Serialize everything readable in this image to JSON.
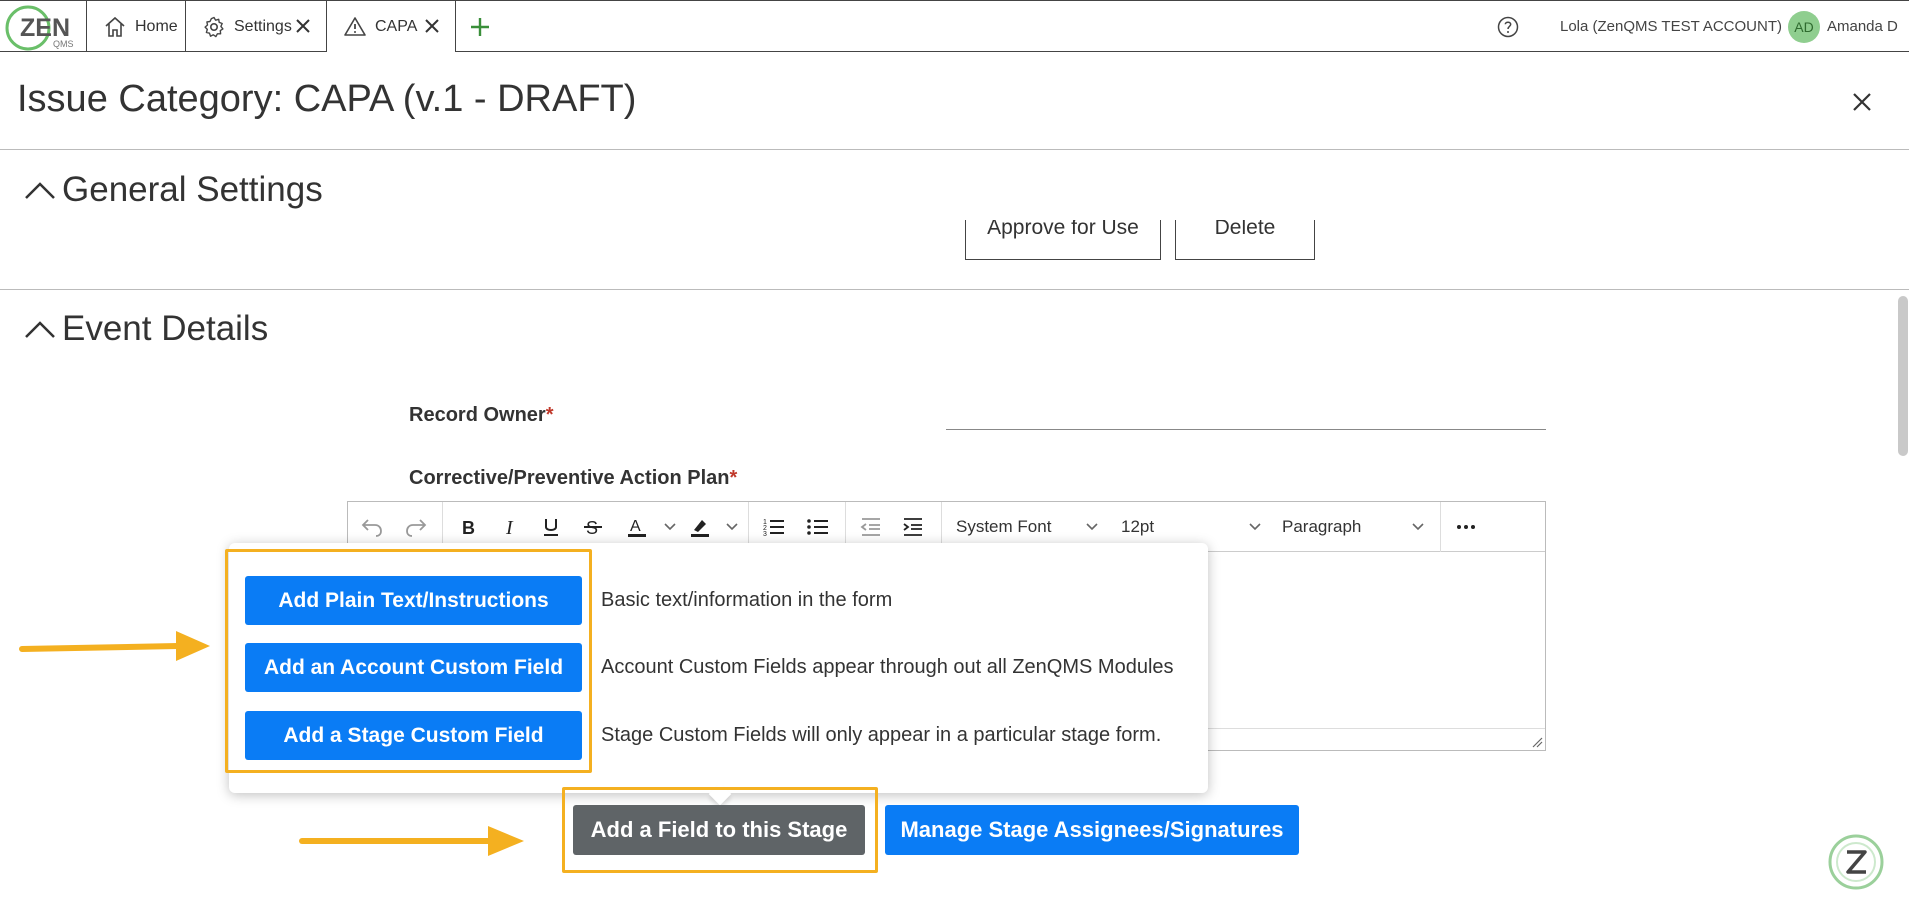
{
  "topbar": {
    "logo_text": "ZEN",
    "logo_sub": "QMS",
    "tabs": [
      {
        "label": "Home",
        "icon": "home-icon"
      },
      {
        "label": "Settings",
        "icon": "gear-icon"
      },
      {
        "label": "CAPA",
        "icon": "warning-icon"
      }
    ],
    "account_label": "Lola (ZenQMS TEST ACCOUNT)",
    "avatar_initials": "AD",
    "user_name": "Amanda D"
  },
  "page": {
    "title": "Issue Category: CAPA (v.1 - DRAFT)"
  },
  "sections": {
    "general": {
      "title": "General Settings",
      "approve_label": "Approve for Use",
      "delete_label": "Delete"
    },
    "event": {
      "title": "Event Details",
      "record_owner_label": "Record Owner",
      "capa_plan_label": "Corrective/Preventive Action Plan",
      "required_mark": "*"
    }
  },
  "editor": {
    "font_family": "System Font",
    "font_size": "12pt",
    "block_format": "Paragraph"
  },
  "popover": {
    "items": [
      {
        "button": "Add Plain Text/Instructions",
        "description": "Basic text/information in the form"
      },
      {
        "button": "Add an Account Custom Field",
        "description": "Account Custom Fields appear through out all ZenQMS Modules"
      },
      {
        "button": "Add a Stage Custom Field",
        "description": "Stage Custom Fields will only appear in a particular stage form."
      }
    ]
  },
  "actions": {
    "add_field_label": "Add a Field to this Stage",
    "manage_label": "Manage Stage Assignees/Signatures"
  },
  "colors": {
    "primary": "#0a7cf5",
    "highlight": "#f4b020",
    "dark_button": "#5f6467",
    "brand_green": "#6abf69"
  }
}
